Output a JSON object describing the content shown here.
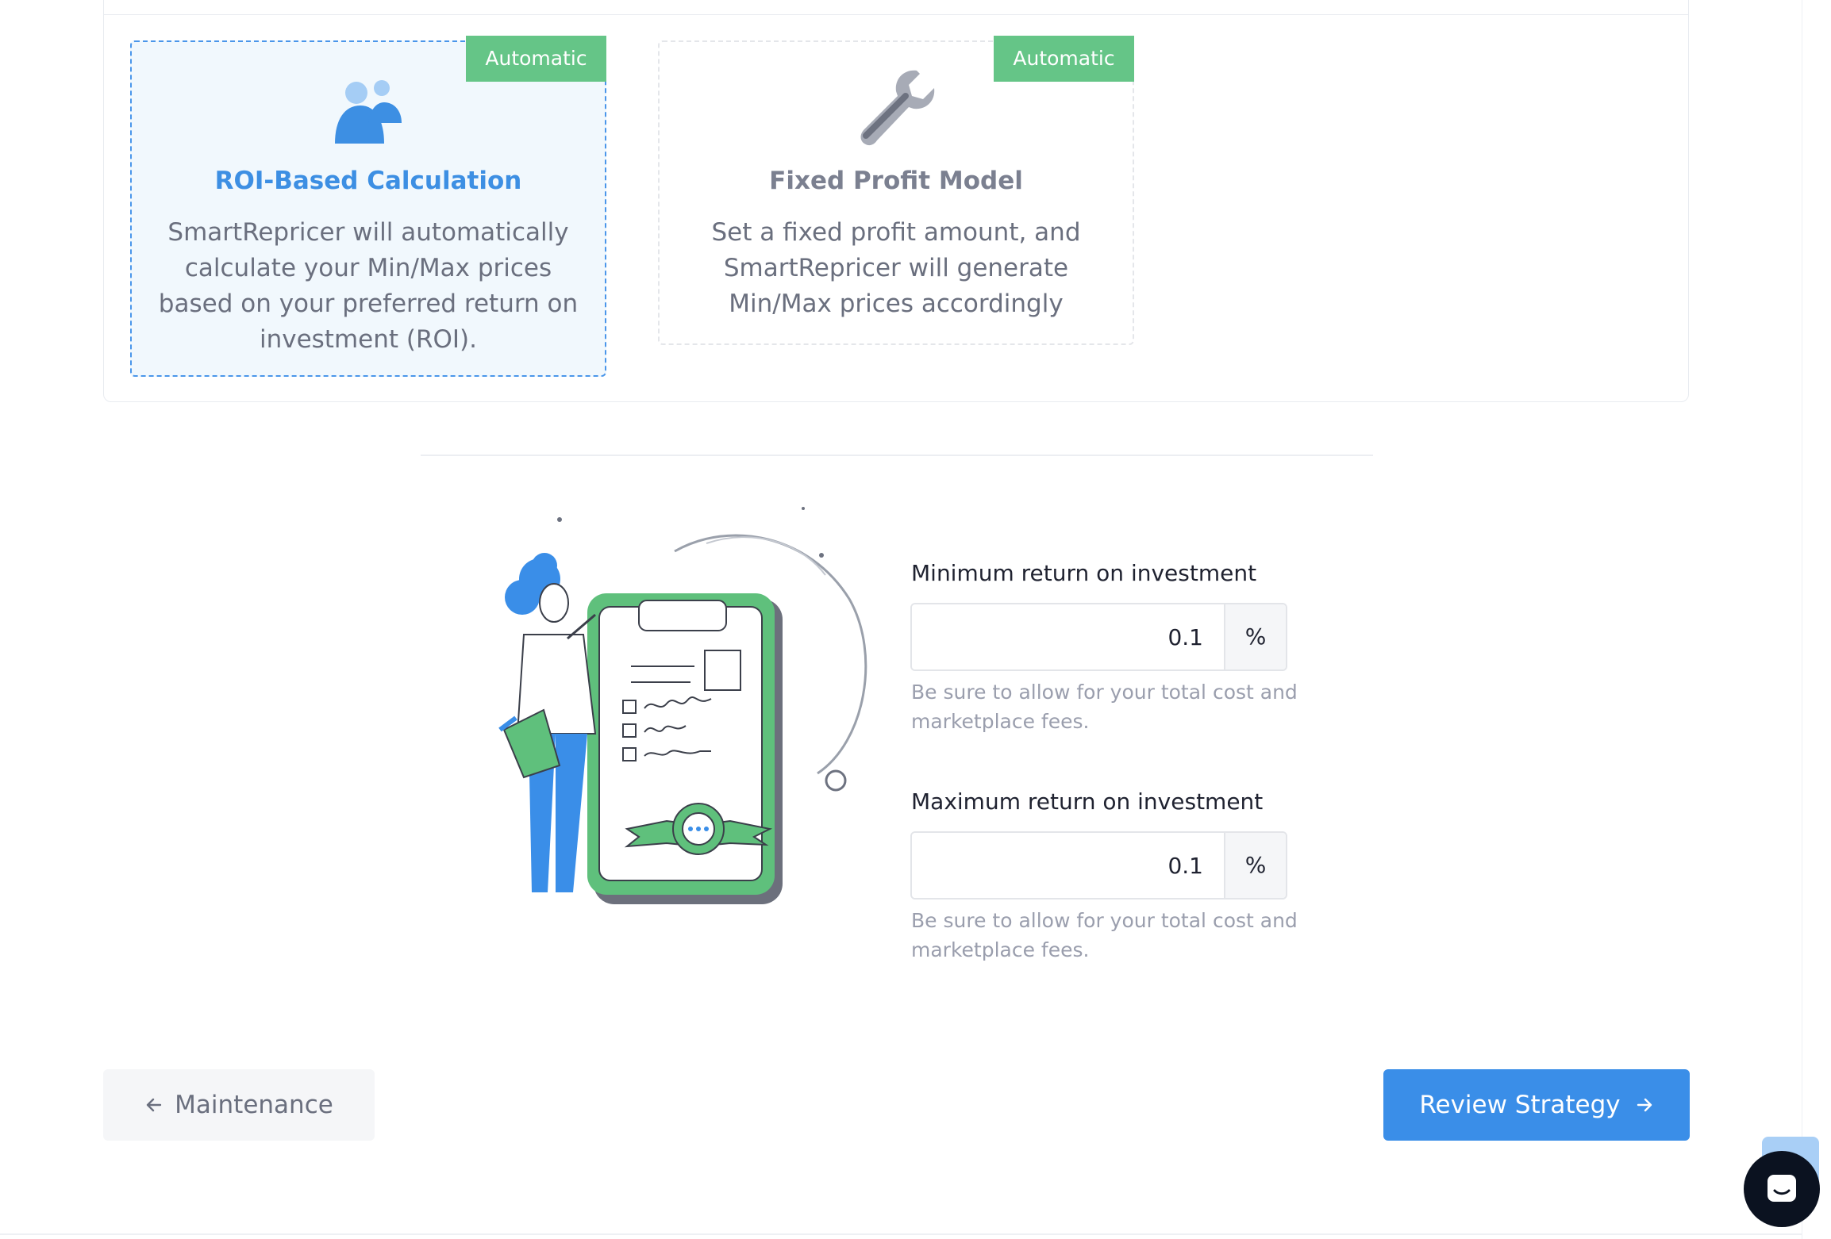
{
  "methods": [
    {
      "badge": "Automatic",
      "icon": "users-icon",
      "title": "ROI-Based Calculation",
      "description": "SmartRepricer will automatically calculate your Min/Max prices based on your preferred return on investment (ROI).",
      "selected": true
    },
    {
      "badge": "Automatic",
      "icon": "wrench-icon",
      "title": "Fixed Profit Model",
      "description": "Set a fixed profit amount, and SmartRepricer will generate Min/Max prices accordingly",
      "selected": false
    }
  ],
  "form": {
    "min_roi": {
      "label": "Minimum return on investment",
      "value": "0.1",
      "suffix": "%",
      "hint": "Be sure to allow for your total cost and marketplace fees."
    },
    "max_roi": {
      "label": "Maximum return on investment",
      "value": "0.1",
      "suffix": "%",
      "hint": "Be sure to allow for your total cost and marketplace fees."
    }
  },
  "nav": {
    "back_label": "Maintenance",
    "next_label": "Review Strategy"
  },
  "colors": {
    "primary": "#3a8ee8",
    "badge": "#65c587",
    "selected_bg": "#f1f8fd",
    "launcher": "#0b1220"
  }
}
